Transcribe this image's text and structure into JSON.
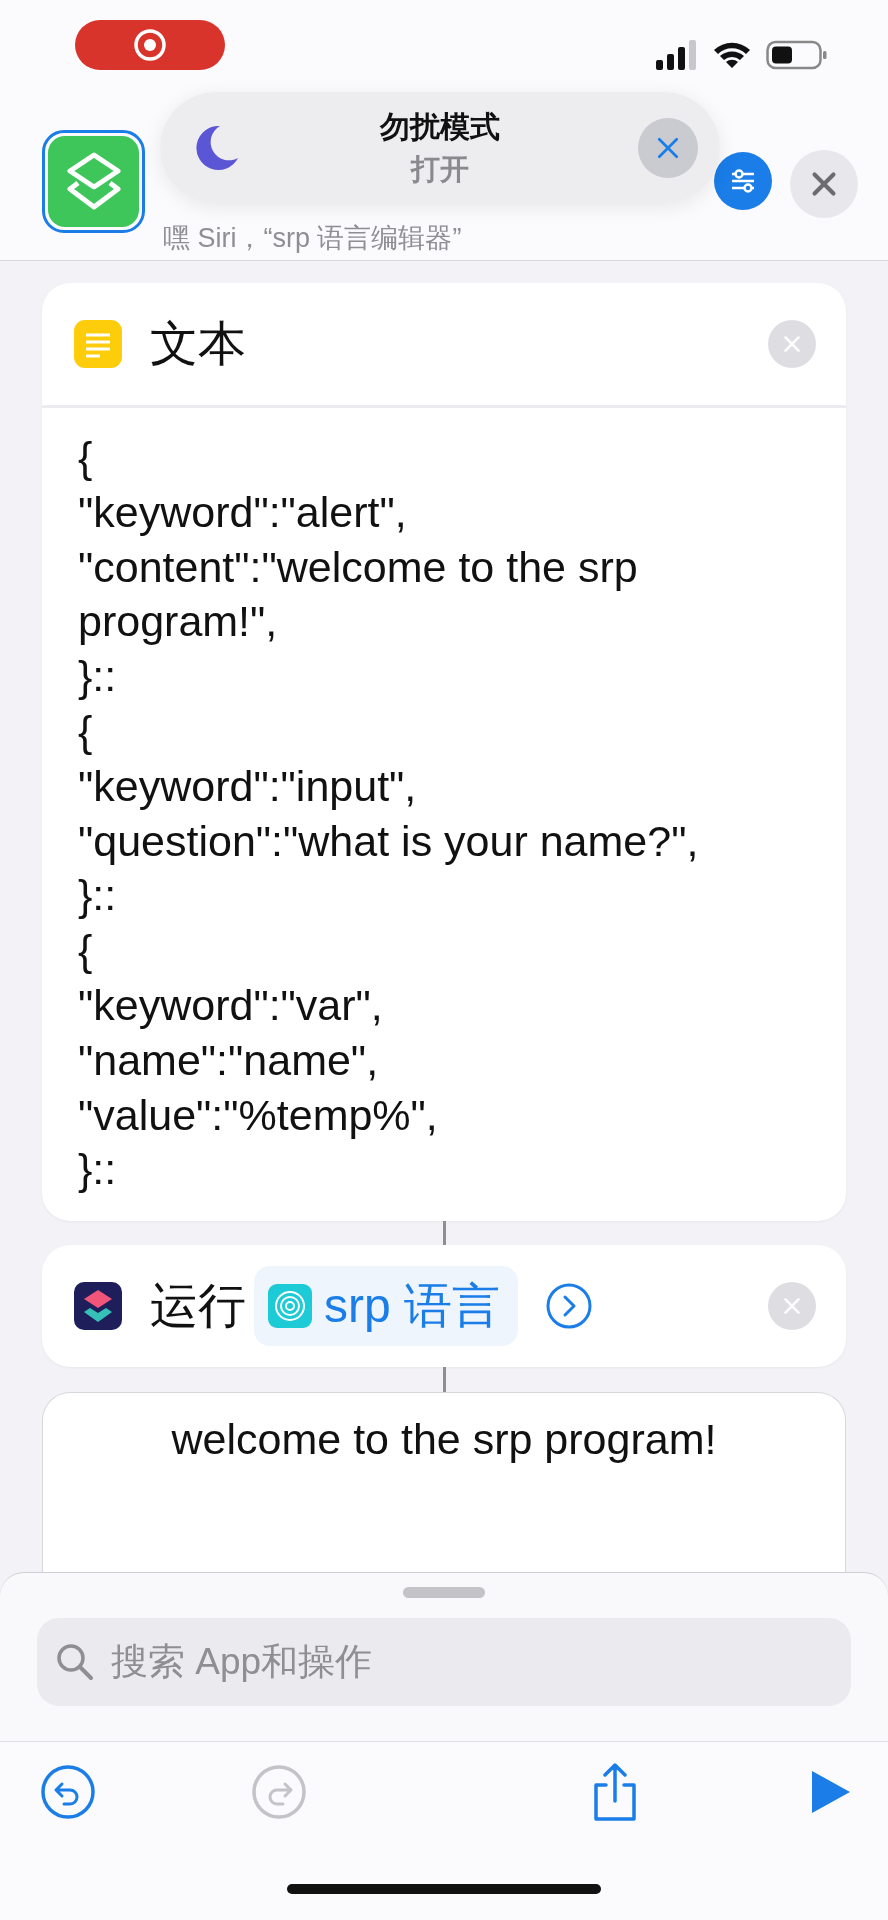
{
  "banner": {
    "title": "勿扰模式",
    "status": "打开"
  },
  "header": {
    "subtitle": "嘿 Siri，“srp 语言编辑器”"
  },
  "text_action": {
    "title": "文本",
    "lines": [
      "{",
      "\"keyword\":\"alert\",",
      "\"content\":\"welcome to the srp",
      "program!\",",
      "}::",
      "{",
      "\"keyword\":\"input\",",
      "\"question\":\"what is your name?\",",
      "}::",
      "{",
      "\"keyword\":\"var\",",
      "\"name\":\"name\",",
      "\"value\":\"%temp%\",",
      "}::"
    ]
  },
  "run_action": {
    "verb": "运行",
    "shortcut": "srp 语言"
  },
  "output": {
    "text": "welcome to the srp program!"
  },
  "search": {
    "placeholder": "搜索 App和操作"
  },
  "toolbar": [
    {
      "kind": "undo",
      "disabled": false
    },
    {
      "kind": "redo",
      "disabled": true
    },
    {
      "kind": "share",
      "disabled": false
    },
    {
      "kind": "play",
      "disabled": false
    }
  ]
}
